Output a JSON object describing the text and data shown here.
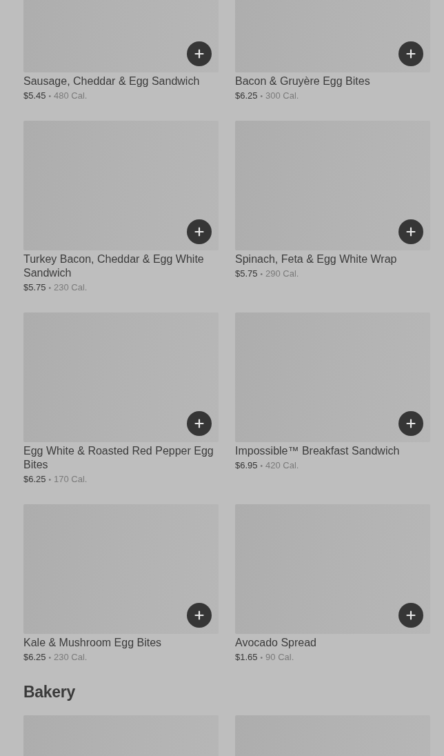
{
  "sections": [
    {
      "items": [
        {
          "kind": "product",
          "name": "Sausage, Cheddar & Egg Sandwich",
          "price": "$5.45",
          "separator": "•",
          "calories": "480 Cal."
        },
        {
          "kind": "product",
          "name": "Bacon & Gruyère Egg Bites",
          "price": "$6.25",
          "separator": "•",
          "calories": "300 Cal."
        },
        {
          "kind": "product",
          "name": "Turkey Bacon, Cheddar & Egg White Sandwich",
          "price": "$5.75",
          "separator": "•",
          "calories": "230 Cal."
        },
        {
          "kind": "product",
          "name": "Spinach, Feta & Egg White Wrap",
          "price": "$5.75",
          "separator": "•",
          "calories": "290 Cal."
        },
        {
          "kind": "product",
          "name": "Egg White & Roasted Red Pepper Egg Bites",
          "price": "$6.25",
          "separator": "•",
          "calories": "170 Cal."
        },
        {
          "kind": "product",
          "name": "Impossible™ Breakfast Sandwich",
          "price": "$6.95",
          "separator": "•",
          "calories": "420 Cal."
        },
        {
          "kind": "product",
          "name": "Kale & Mushroom Egg Bites",
          "price": "$6.25",
          "separator": "•",
          "calories": "230 Cal."
        },
        {
          "kind": "product",
          "name": "Avocado Spread",
          "price": "$1.65",
          "separator": "•",
          "calories": "90 Cal."
        }
      ]
    },
    {
      "title": "Bakery"
    }
  ]
}
